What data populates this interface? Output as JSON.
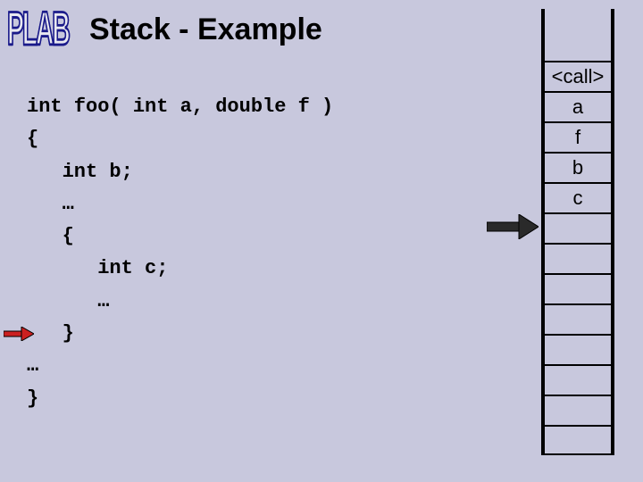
{
  "logo": "PLAB",
  "title": "Stack - Example",
  "code_lines": [
    "int foo( int a, double f )",
    "{",
    "   int b;",
    "   …",
    "   {",
    "      int c;",
    "      …",
    "   }",
    "…",
    "}"
  ],
  "stack": {
    "cells": [
      "",
      "<call>",
      "a",
      "f",
      "b",
      "c",
      "",
      "",
      "",
      "",
      "",
      "",
      "",
      ""
    ]
  }
}
